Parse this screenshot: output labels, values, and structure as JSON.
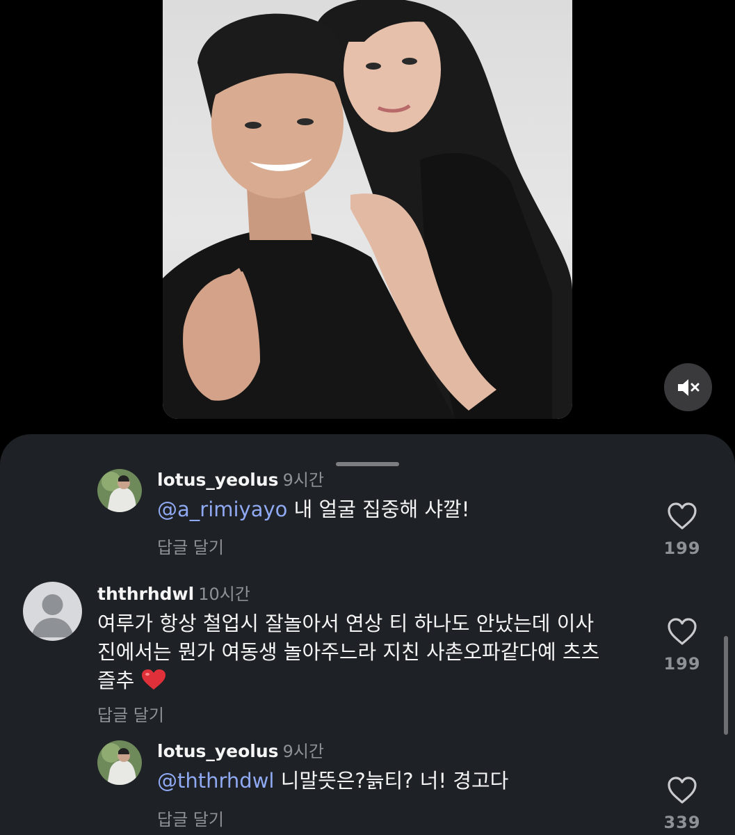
{
  "sheet": {
    "title": ""
  },
  "comments": [
    {
      "username": "lotus_yeolus",
      "time": "9시간",
      "mention": "@a_rimiyayo",
      "text": " 내 얼굴 집중해 샤깔!",
      "reply_label": "답글 달기",
      "likes": "199"
    },
    {
      "username": "ththrhdwl",
      "time": "10시간",
      "line1": "여루가 항상 철업시 잘놀아서 연상 티 하나도 안났는데 이사",
      "line2": "진에서는 뭔가 여동생 놀아주느라 지친 사촌오파같다예 츠츠",
      "line3": "즐추",
      "reply_label": "답글 달기",
      "likes": "199"
    },
    {
      "username": "lotus_yeolus",
      "time": "9시간",
      "mention": "@ththrhdwl",
      "text": " 니말뜻은?늙티? 너! 경고다",
      "reply_label": "답글 달기",
      "likes": "339"
    }
  ],
  "icons": {
    "mute": "speaker-muted-icon",
    "like": "heart-outline-icon",
    "reaction": "red-heart-emoji"
  },
  "colors": {
    "sheet_bg": "#1e2125",
    "mention": "#8fa9f2",
    "secondary_text": "#8e9196",
    "heart_emoji": "#e0303a"
  }
}
